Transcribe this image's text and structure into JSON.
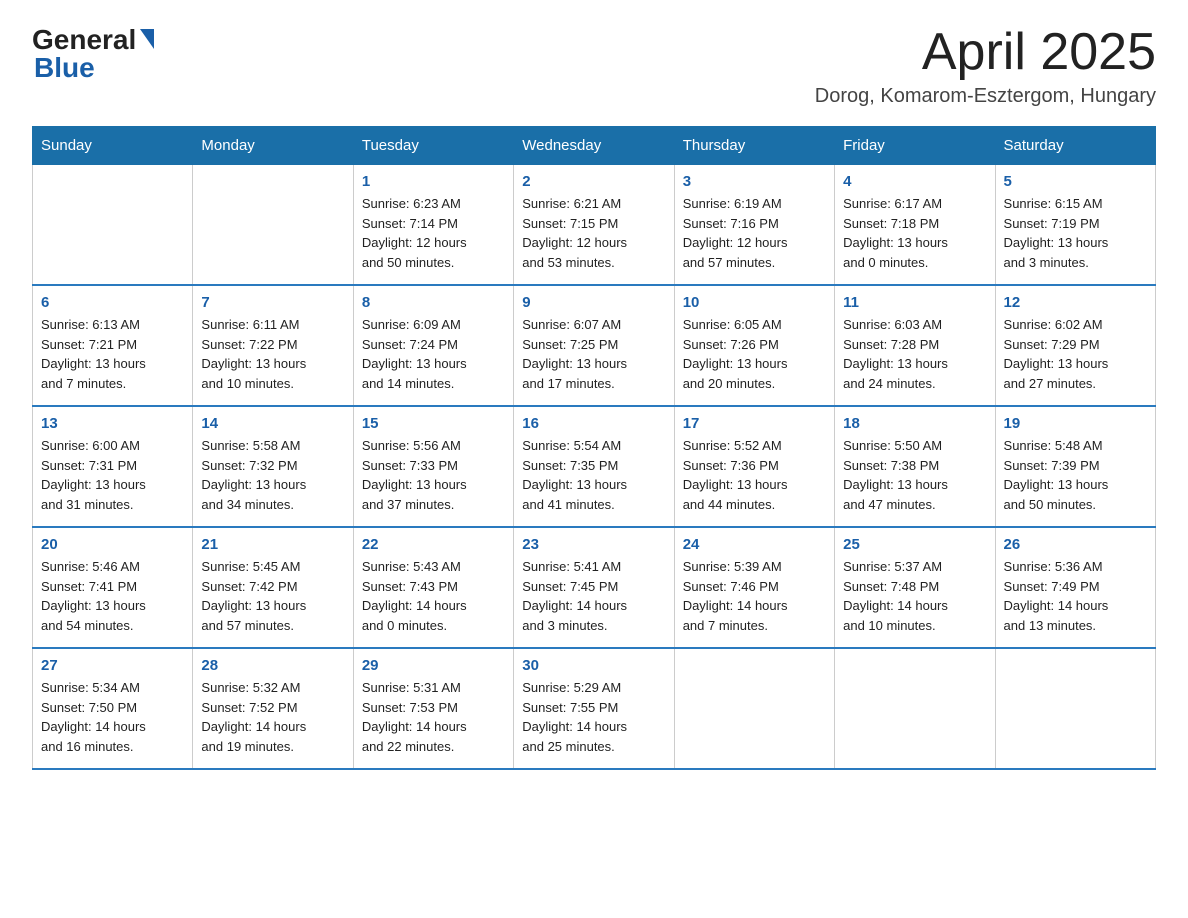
{
  "header": {
    "logo_general": "General",
    "logo_blue": "Blue",
    "month_title": "April 2025",
    "location": "Dorog, Komarom-Esztergom, Hungary"
  },
  "weekdays": [
    "Sunday",
    "Monday",
    "Tuesday",
    "Wednesday",
    "Thursday",
    "Friday",
    "Saturday"
  ],
  "weeks": [
    [
      {
        "day": "",
        "info": ""
      },
      {
        "day": "",
        "info": ""
      },
      {
        "day": "1",
        "info": "Sunrise: 6:23 AM\nSunset: 7:14 PM\nDaylight: 12 hours\nand 50 minutes."
      },
      {
        "day": "2",
        "info": "Sunrise: 6:21 AM\nSunset: 7:15 PM\nDaylight: 12 hours\nand 53 minutes."
      },
      {
        "day": "3",
        "info": "Sunrise: 6:19 AM\nSunset: 7:16 PM\nDaylight: 12 hours\nand 57 minutes."
      },
      {
        "day": "4",
        "info": "Sunrise: 6:17 AM\nSunset: 7:18 PM\nDaylight: 13 hours\nand 0 minutes."
      },
      {
        "day": "5",
        "info": "Sunrise: 6:15 AM\nSunset: 7:19 PM\nDaylight: 13 hours\nand 3 minutes."
      }
    ],
    [
      {
        "day": "6",
        "info": "Sunrise: 6:13 AM\nSunset: 7:21 PM\nDaylight: 13 hours\nand 7 minutes."
      },
      {
        "day": "7",
        "info": "Sunrise: 6:11 AM\nSunset: 7:22 PM\nDaylight: 13 hours\nand 10 minutes."
      },
      {
        "day": "8",
        "info": "Sunrise: 6:09 AM\nSunset: 7:24 PM\nDaylight: 13 hours\nand 14 minutes."
      },
      {
        "day": "9",
        "info": "Sunrise: 6:07 AM\nSunset: 7:25 PM\nDaylight: 13 hours\nand 17 minutes."
      },
      {
        "day": "10",
        "info": "Sunrise: 6:05 AM\nSunset: 7:26 PM\nDaylight: 13 hours\nand 20 minutes."
      },
      {
        "day": "11",
        "info": "Sunrise: 6:03 AM\nSunset: 7:28 PM\nDaylight: 13 hours\nand 24 minutes."
      },
      {
        "day": "12",
        "info": "Sunrise: 6:02 AM\nSunset: 7:29 PM\nDaylight: 13 hours\nand 27 minutes."
      }
    ],
    [
      {
        "day": "13",
        "info": "Sunrise: 6:00 AM\nSunset: 7:31 PM\nDaylight: 13 hours\nand 31 minutes."
      },
      {
        "day": "14",
        "info": "Sunrise: 5:58 AM\nSunset: 7:32 PM\nDaylight: 13 hours\nand 34 minutes."
      },
      {
        "day": "15",
        "info": "Sunrise: 5:56 AM\nSunset: 7:33 PM\nDaylight: 13 hours\nand 37 minutes."
      },
      {
        "day": "16",
        "info": "Sunrise: 5:54 AM\nSunset: 7:35 PM\nDaylight: 13 hours\nand 41 minutes."
      },
      {
        "day": "17",
        "info": "Sunrise: 5:52 AM\nSunset: 7:36 PM\nDaylight: 13 hours\nand 44 minutes."
      },
      {
        "day": "18",
        "info": "Sunrise: 5:50 AM\nSunset: 7:38 PM\nDaylight: 13 hours\nand 47 minutes."
      },
      {
        "day": "19",
        "info": "Sunrise: 5:48 AM\nSunset: 7:39 PM\nDaylight: 13 hours\nand 50 minutes."
      }
    ],
    [
      {
        "day": "20",
        "info": "Sunrise: 5:46 AM\nSunset: 7:41 PM\nDaylight: 13 hours\nand 54 minutes."
      },
      {
        "day": "21",
        "info": "Sunrise: 5:45 AM\nSunset: 7:42 PM\nDaylight: 13 hours\nand 57 minutes."
      },
      {
        "day": "22",
        "info": "Sunrise: 5:43 AM\nSunset: 7:43 PM\nDaylight: 14 hours\nand 0 minutes."
      },
      {
        "day": "23",
        "info": "Sunrise: 5:41 AM\nSunset: 7:45 PM\nDaylight: 14 hours\nand 3 minutes."
      },
      {
        "day": "24",
        "info": "Sunrise: 5:39 AM\nSunset: 7:46 PM\nDaylight: 14 hours\nand 7 minutes."
      },
      {
        "day": "25",
        "info": "Sunrise: 5:37 AM\nSunset: 7:48 PM\nDaylight: 14 hours\nand 10 minutes."
      },
      {
        "day": "26",
        "info": "Sunrise: 5:36 AM\nSunset: 7:49 PM\nDaylight: 14 hours\nand 13 minutes."
      }
    ],
    [
      {
        "day": "27",
        "info": "Sunrise: 5:34 AM\nSunset: 7:50 PM\nDaylight: 14 hours\nand 16 minutes."
      },
      {
        "day": "28",
        "info": "Sunrise: 5:32 AM\nSunset: 7:52 PM\nDaylight: 14 hours\nand 19 minutes."
      },
      {
        "day": "29",
        "info": "Sunrise: 5:31 AM\nSunset: 7:53 PM\nDaylight: 14 hours\nand 22 minutes."
      },
      {
        "day": "30",
        "info": "Sunrise: 5:29 AM\nSunset: 7:55 PM\nDaylight: 14 hours\nand 25 minutes."
      },
      {
        "day": "",
        "info": ""
      },
      {
        "day": "",
        "info": ""
      },
      {
        "day": "",
        "info": ""
      }
    ]
  ]
}
